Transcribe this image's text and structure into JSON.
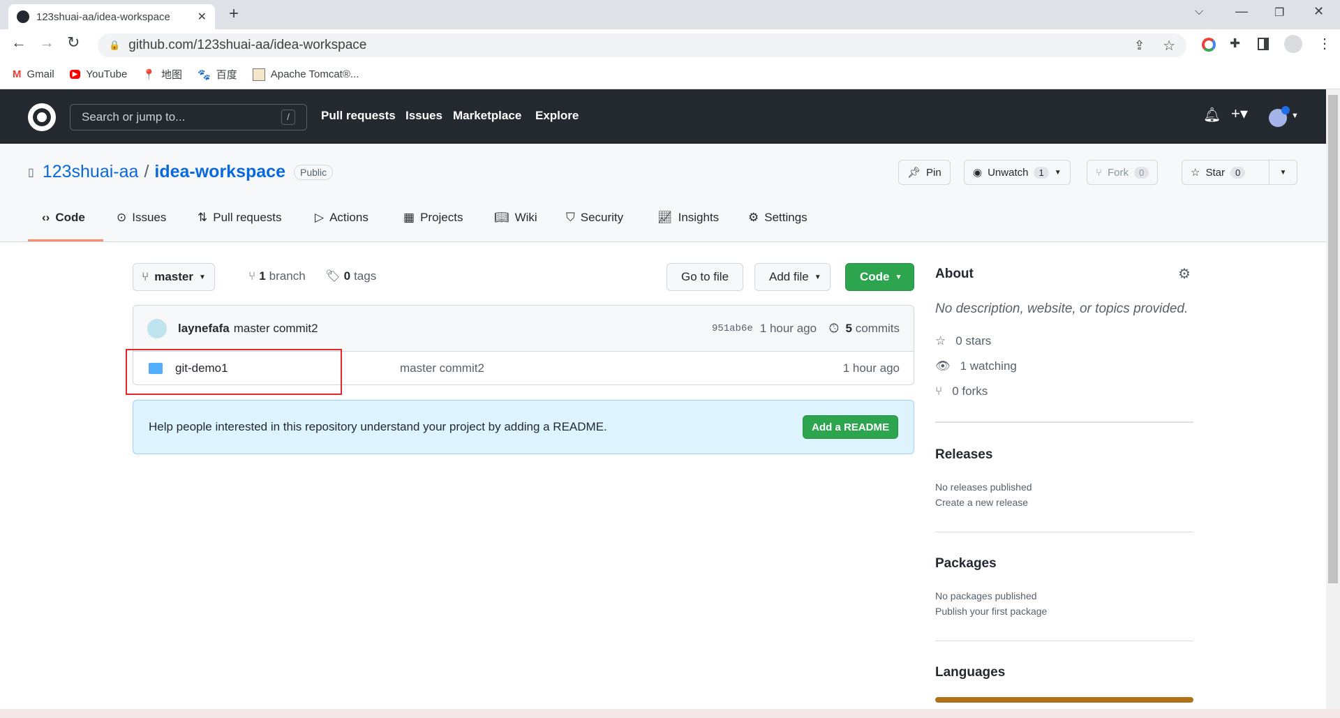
{
  "browser": {
    "tab_title": "123shuai-aa/idea-workspace",
    "url": "github.com/123shuai-aa/idea-workspace",
    "bookmarks": [
      "Gmail",
      "YouTube",
      "地图",
      "百度",
      "Apache Tomcat®..."
    ]
  },
  "header": {
    "search_placeholder": "Search or jump to...",
    "search_key": "/",
    "nav": [
      "Pull requests",
      "Issues",
      "Marketplace",
      "Explore"
    ]
  },
  "repo": {
    "owner": "123shuai-aa",
    "sep": "/",
    "name": "idea-workspace",
    "visibility": "Public",
    "pin": "Pin",
    "unwatch": "Unwatch",
    "watch_count": "1",
    "fork": "Fork",
    "fork_count": "0",
    "star": "Star",
    "star_count": "0",
    "tabs": [
      "Code",
      "Issues",
      "Pull requests",
      "Actions",
      "Projects",
      "Wiki",
      "Security",
      "Insights",
      "Settings"
    ],
    "active_tab": "Code"
  },
  "toolbar": {
    "branch": "master",
    "branches_num": "1",
    "branches_label": "branch",
    "tags_num": "0",
    "tags_label": "tags",
    "go_to_file": "Go to file",
    "add_file": "Add file",
    "code": "Code"
  },
  "commit": {
    "author": "laynefafa",
    "message": "master commit2",
    "sha": "951ab6e",
    "time": "1 hour ago",
    "commits_num": "5",
    "commits_label": "commits"
  },
  "files": [
    {
      "name": "git-demo1",
      "type": "folder",
      "message": "master commit2",
      "time": "1 hour ago"
    }
  ],
  "readme": {
    "text": "Help people interested in this repository understand your project by adding a README.",
    "button": "Add a README"
  },
  "about": {
    "title": "About",
    "description": "No description, website, or topics provided.",
    "stars": "0 stars",
    "watching": "1 watching",
    "forks": "0 forks"
  },
  "releases": {
    "title": "Releases",
    "text": "No releases published",
    "link": "Create a new release"
  },
  "packages": {
    "title": "Packages",
    "text": "No packages published",
    "link": "Publish your first package"
  },
  "languages": {
    "title": "Languages",
    "bar_color": "#b07219",
    "share": 100
  },
  "colors": {
    "accent": "#2da44e",
    "highlight": "#e5252a",
    "tab_underline": "#fd8c73"
  }
}
